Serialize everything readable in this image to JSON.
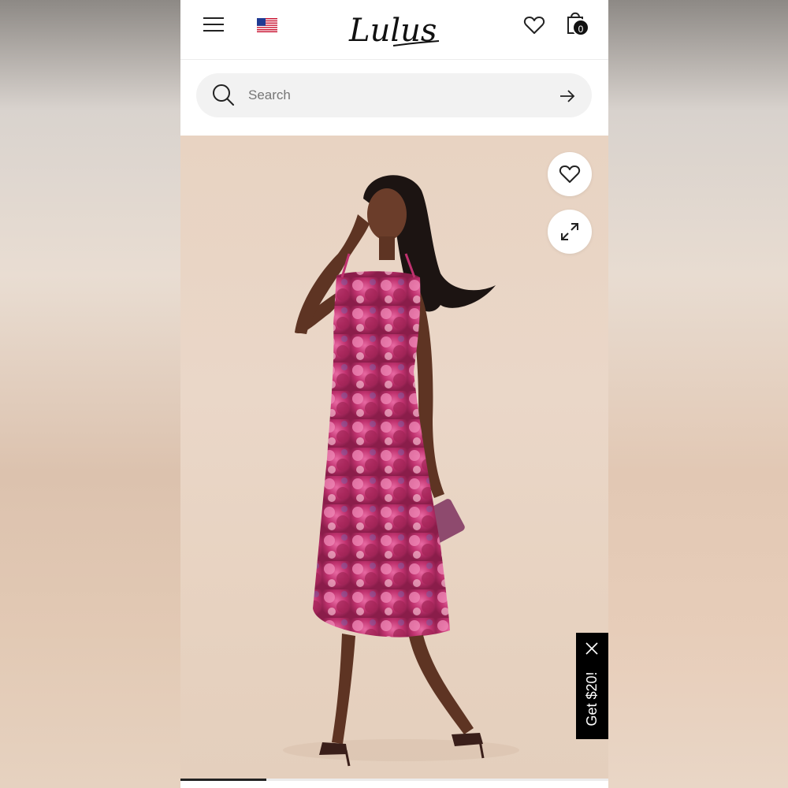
{
  "header": {
    "brand": "Lulus",
    "bag_count": "0",
    "menu_icon": "hamburger-menu-icon",
    "flag_icon": "us-flag-icon",
    "wishlist_icon": "heart-icon",
    "bag_icon": "shopping-bag-icon"
  },
  "search": {
    "placeholder": "Search",
    "value": "",
    "icon": "search-icon",
    "submit_icon": "arrow-right-icon"
  },
  "product_image": {
    "wishlist_icon": "heart-icon",
    "expand_icon": "expand-icon",
    "gallery_progress": 0.2
  },
  "promo": {
    "label": "Get $20!",
    "close_icon": "close-icon"
  },
  "colors": {
    "accent": "#111111",
    "background": "#ffffff",
    "search_bg": "#f2f2f2",
    "dress_pink": "#c03a72"
  }
}
